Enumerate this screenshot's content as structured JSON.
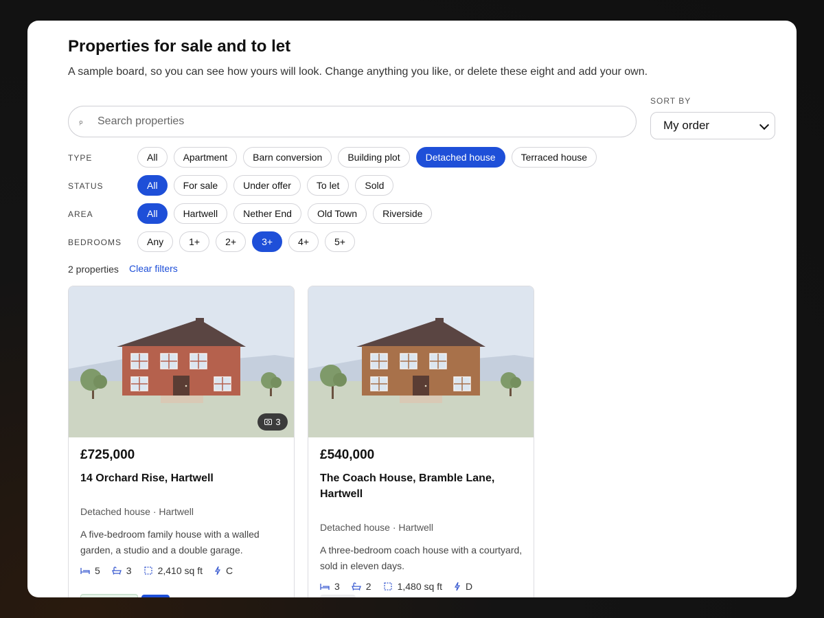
{
  "header": {
    "title": "Properties for sale and to let",
    "subtitle": "A sample board, so you can see how yours will look. Change anything you like, or delete these eight and add your own."
  },
  "search": {
    "placeholder": "Search properties",
    "icon": "search-icon"
  },
  "sort": {
    "label": "SORT BY",
    "selected": "My order"
  },
  "filters": {
    "type": {
      "label": "TYPE",
      "options": [
        "All",
        "Apartment",
        "Barn conversion",
        "Building plot",
        "Detached house",
        "Terraced house"
      ],
      "active": "Detached house"
    },
    "status": {
      "label": "STATUS",
      "options": [
        "All",
        "For sale",
        "Under offer",
        "To let",
        "Sold"
      ],
      "active": "All"
    },
    "area": {
      "label": "AREA",
      "options": [
        "All",
        "Hartwell",
        "Nether End",
        "Old Town",
        "Riverside"
      ],
      "active": "All"
    },
    "bedrooms": {
      "label": "BEDROOMS",
      "options": [
        "Any",
        "1+",
        "2+",
        "3+",
        "4+",
        "5+"
      ],
      "active": "3+"
    }
  },
  "results": {
    "count": "2 properties",
    "clear": "Clear filters"
  },
  "colors": {
    "accent": "#1e4fd8",
    "house_1_wall": "#b5614d",
    "house_2_wall": "#a8714a",
    "roof": "#5a4542",
    "sky": "#dde5ef",
    "ground": "#cdd5c3"
  },
  "listings": [
    {
      "price": "£725,000",
      "name": "14 Orchard Rise, Hartwell",
      "meta": "Detached house · Hartwell",
      "description": "A five-bedroom family house with a walled garden, a studio and a double garage.",
      "photos": "3",
      "beds": "5",
      "baths": "3",
      "area": "2,410 sq ft",
      "energy": "C"
    },
    {
      "price": "£540,000",
      "name": "The Coach House, Bramble Lane, Hartwell",
      "meta": "Detached house · Hartwell",
      "description": "A three-bedroom coach house with a courtyard, sold in eleven days.",
      "beds": "3",
      "baths": "2",
      "area": "1,480 sq ft",
      "energy": "D"
    }
  ]
}
